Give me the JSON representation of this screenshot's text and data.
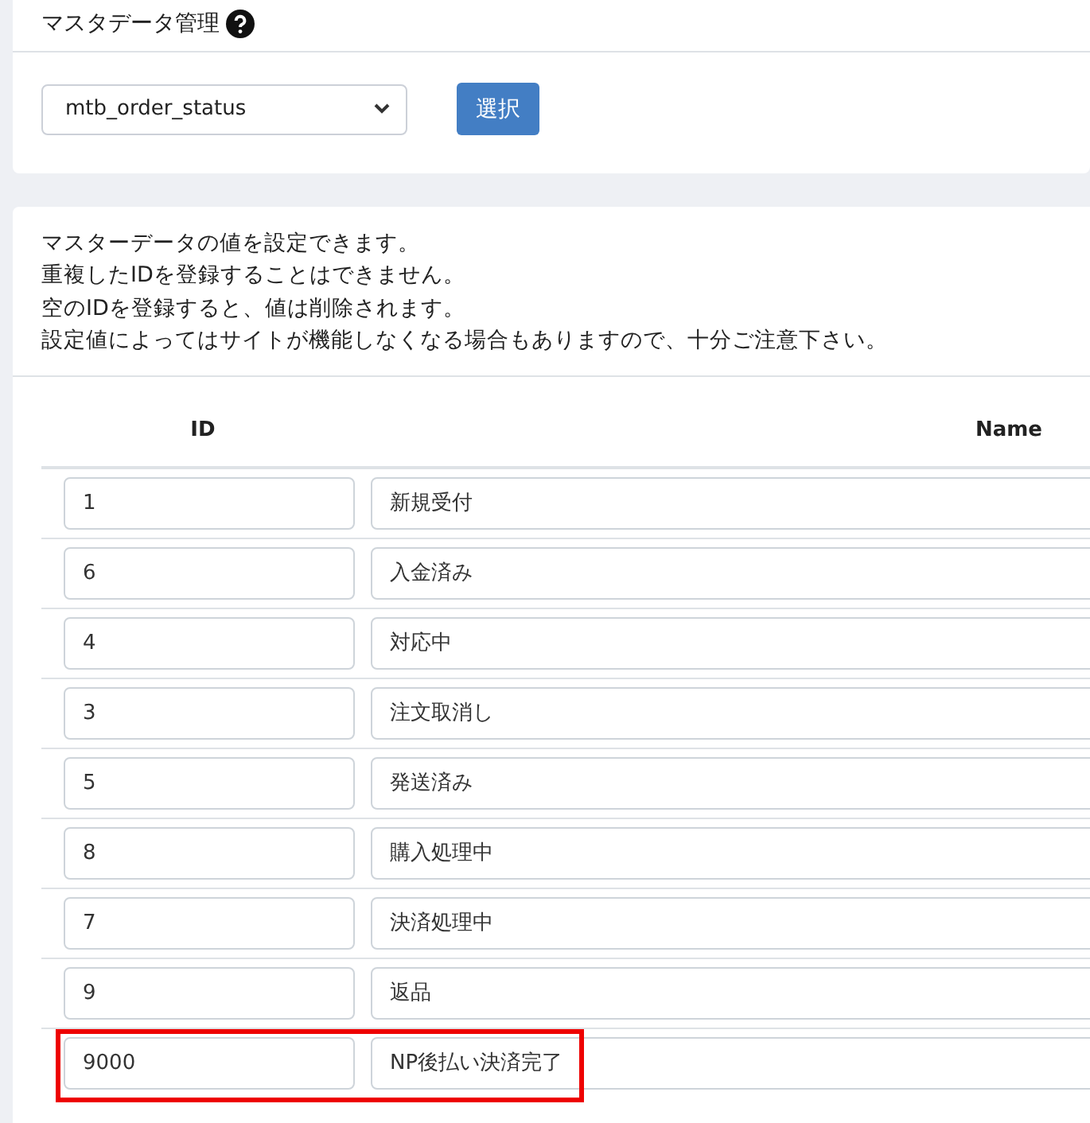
{
  "header": {
    "title": "マスタデータ管理"
  },
  "selector": {
    "value": "mtb_order_status",
    "button": "選択"
  },
  "notes": [
    "マスターデータの値を設定できます。",
    "重複したIDを登録することはできません。",
    "空のIDを登録すると、値は削除されます。",
    "設定値によってはサイトが機能しなくなる場合もありますので、十分ご注意下さい。"
  ],
  "table": {
    "columns": [
      "ID",
      "Name"
    ],
    "rows": [
      {
        "id": "1",
        "name": "新規受付",
        "highlighted": false
      },
      {
        "id": "6",
        "name": "入金済み",
        "highlighted": false
      },
      {
        "id": "4",
        "name": "対応中",
        "highlighted": false
      },
      {
        "id": "3",
        "name": "注文取消し",
        "highlighted": false
      },
      {
        "id": "5",
        "name": "発送済み",
        "highlighted": false
      },
      {
        "id": "8",
        "name": "購入処理中",
        "highlighted": false
      },
      {
        "id": "7",
        "name": "決済処理中",
        "highlighted": false
      },
      {
        "id": "9",
        "name": "返品",
        "highlighted": false
      },
      {
        "id": "9000",
        "name": "NP後払い決済完了",
        "highlighted": true
      }
    ]
  }
}
